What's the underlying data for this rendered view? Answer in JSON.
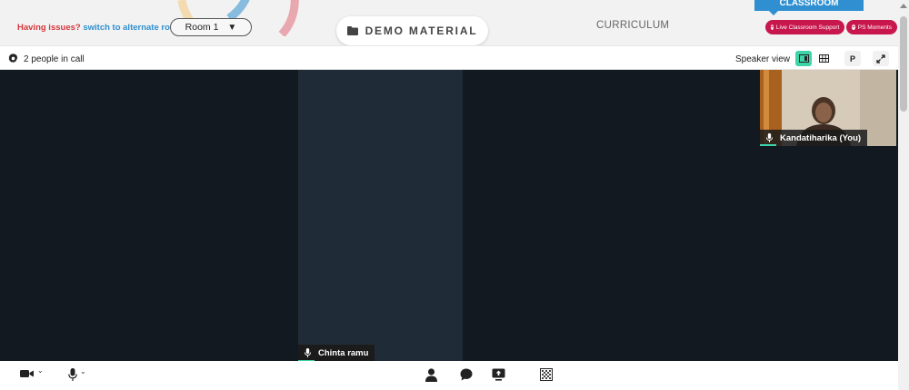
{
  "header": {
    "issue_text": "Having issues?",
    "switch_text": "switch to alternate room",
    "room": "Room 1",
    "demo_material": "DEMO MATERIAL",
    "curriculum": "CURRICULUM",
    "classroom_tab": "CLASSROOM",
    "live_support": "Live Classroom Support",
    "ps_moments": "PS Moments"
  },
  "callbar": {
    "people_count": "2 people in call",
    "view_mode": "Speaker view",
    "p_button": "P"
  },
  "video": {
    "main_participant": "Chinta ramu",
    "self_participant": "Kandatiharika (You)"
  },
  "controls": {
    "icons": [
      "camera-icon",
      "microphone-icon",
      "people-icon",
      "chat-icon",
      "share-screen-icon",
      "background-icon"
    ]
  },
  "colors": {
    "accent_green": "#3ed3a8",
    "pill_red": "#c8174d",
    "issue_red": "#d6363c",
    "link_blue": "#2f8fd0",
    "video_bg": "#131920",
    "tile_bg": "#1f2c37"
  }
}
